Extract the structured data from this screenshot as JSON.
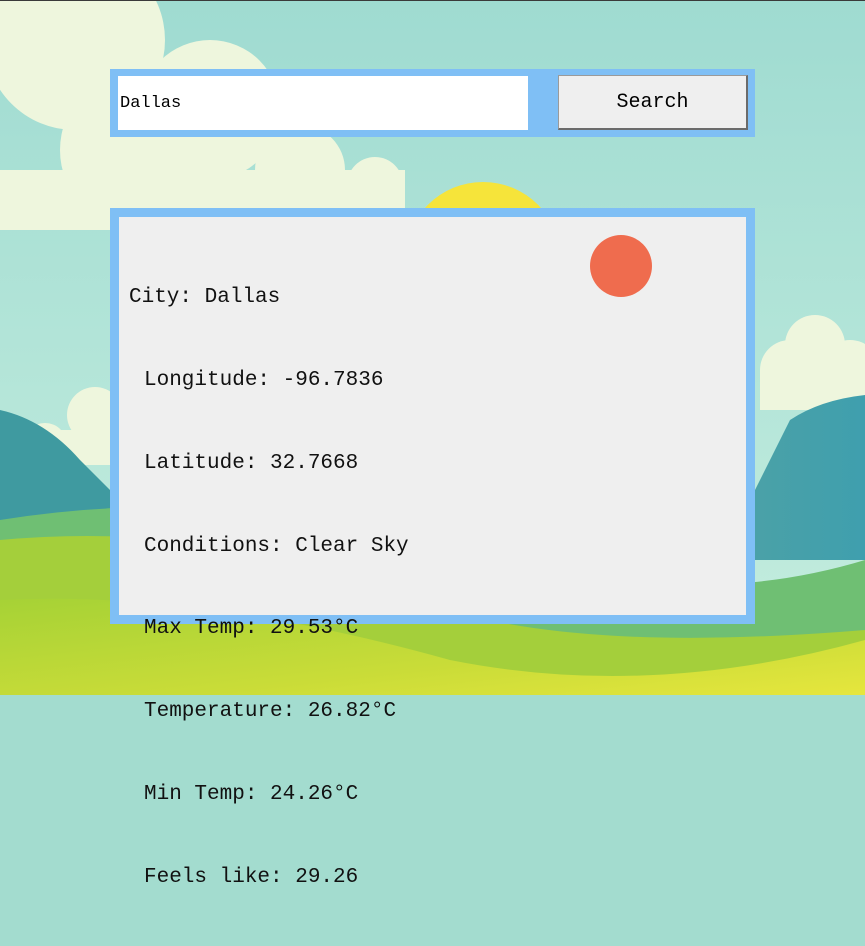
{
  "search": {
    "value": "Dallas",
    "button_label": "Search"
  },
  "result": {
    "lines": [
      "City: Dallas",
      "Longitude: -96.7836",
      "Latitude: 32.7668",
      "Conditions: Clear Sky",
      "Max Temp: 29.53°C",
      "Temperature: 26.82°C",
      "Min Temp: 24.26°C",
      "Feels like: 29.26"
    ],
    "icon": "sun-icon"
  },
  "colors": {
    "frame": "#7fbff5",
    "panel": "#efefef",
    "sun_icon": "#ef6c4e",
    "sky": "#a3dccf",
    "hill_green": "#8ac83a",
    "hill_yellow": "#e1e53a",
    "mountain_teal": "#3c9ea6",
    "sun": "#f5e63a"
  }
}
